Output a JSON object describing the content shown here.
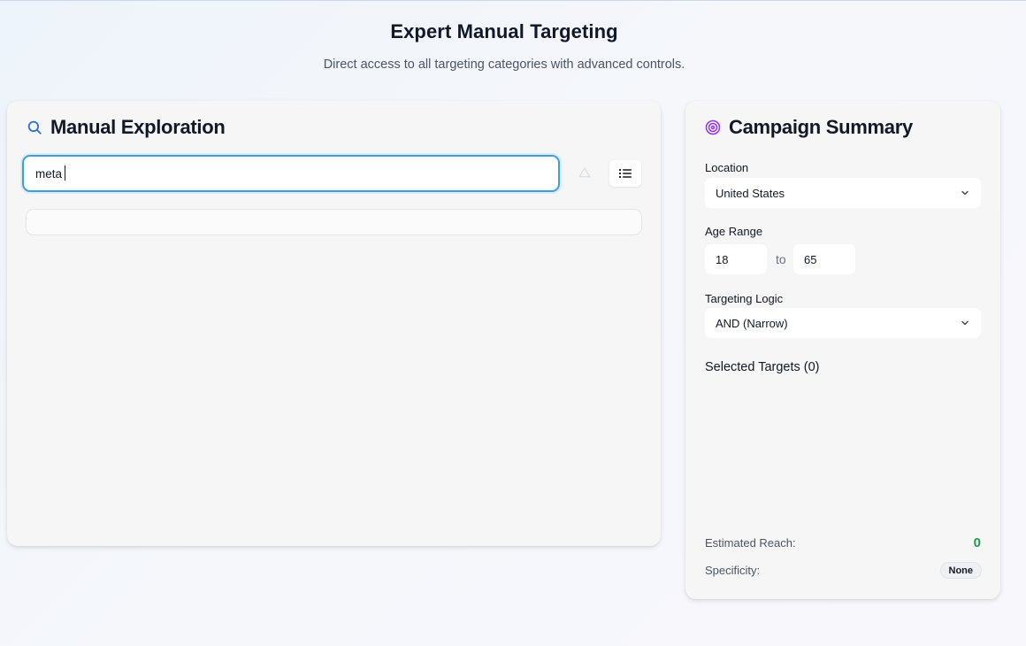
{
  "header": {
    "title": "Expert Manual Targeting",
    "subtitle": "Direct access to all targeting categories with advanced controls."
  },
  "exploration": {
    "title": "Manual Exploration",
    "search_value": "meta",
    "icons": {
      "heading": "search-icon",
      "warning": "warning-icon",
      "view_toggle": "list-icon"
    }
  },
  "summary": {
    "title": "Campaign Summary",
    "location_label": "Location",
    "location_value": "United States",
    "age_label": "Age Range",
    "age_min": "18",
    "age_separator": "to",
    "age_max": "65",
    "logic_label": "Targeting Logic",
    "logic_value": "AND (Narrow)",
    "selected_title": "Selected Targets (0)",
    "reach_label": "Estimated Reach:",
    "reach_value": "0",
    "specificity_label": "Specificity:",
    "specificity_value": "None",
    "icons": {
      "heading": "target-icon",
      "dropdown": "chevron-down-icon"
    }
  },
  "colors": {
    "accent_blue": "#3aa0e0",
    "target_purple": "#9333ea",
    "reach_green": "#1f9a52"
  }
}
